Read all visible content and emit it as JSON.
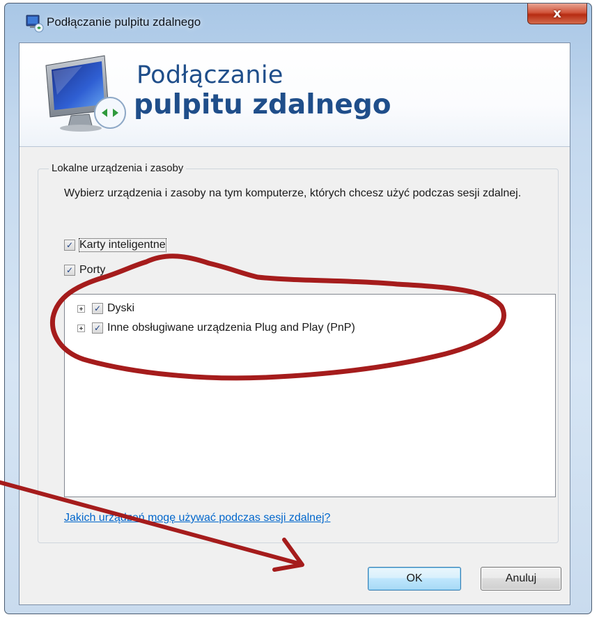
{
  "window": {
    "title": "Podłączanie pulpitu zdalnego",
    "close_glyph": "x"
  },
  "banner": {
    "title_line1": "Podłączanie",
    "title_line2": "pulpitu zdalnego"
  },
  "group": {
    "legend": "Lokalne urządzenia i zasoby",
    "description": "Wybierz urządzenia i zasoby na tym komputerze, których chcesz użyć podczas sesji zdalnej.",
    "checkboxes": [
      {
        "label": "Karty inteligentne",
        "checked": true
      },
      {
        "label": "Porty",
        "checked": true
      }
    ],
    "tree": [
      {
        "label": "Dyski",
        "checked": true,
        "expandable": true
      },
      {
        "label": "Inne obsługiwane urządzenia Plug and Play (PnP)",
        "checked": true,
        "expandable": true
      }
    ],
    "check_glyph": "✓"
  },
  "help_link": "Jakich urządzeń mogę używać podczas sesji zdalnej?",
  "buttons": {
    "ok": "OK",
    "cancel": "Anuluj"
  },
  "colors": {
    "annotation": "#a51c1c",
    "title_text": "#1f4e8a",
    "link": "#0066cc"
  },
  "icons": {
    "app": "remote-desktop-icon",
    "banner": "remote-desktop-monitor-icon"
  }
}
